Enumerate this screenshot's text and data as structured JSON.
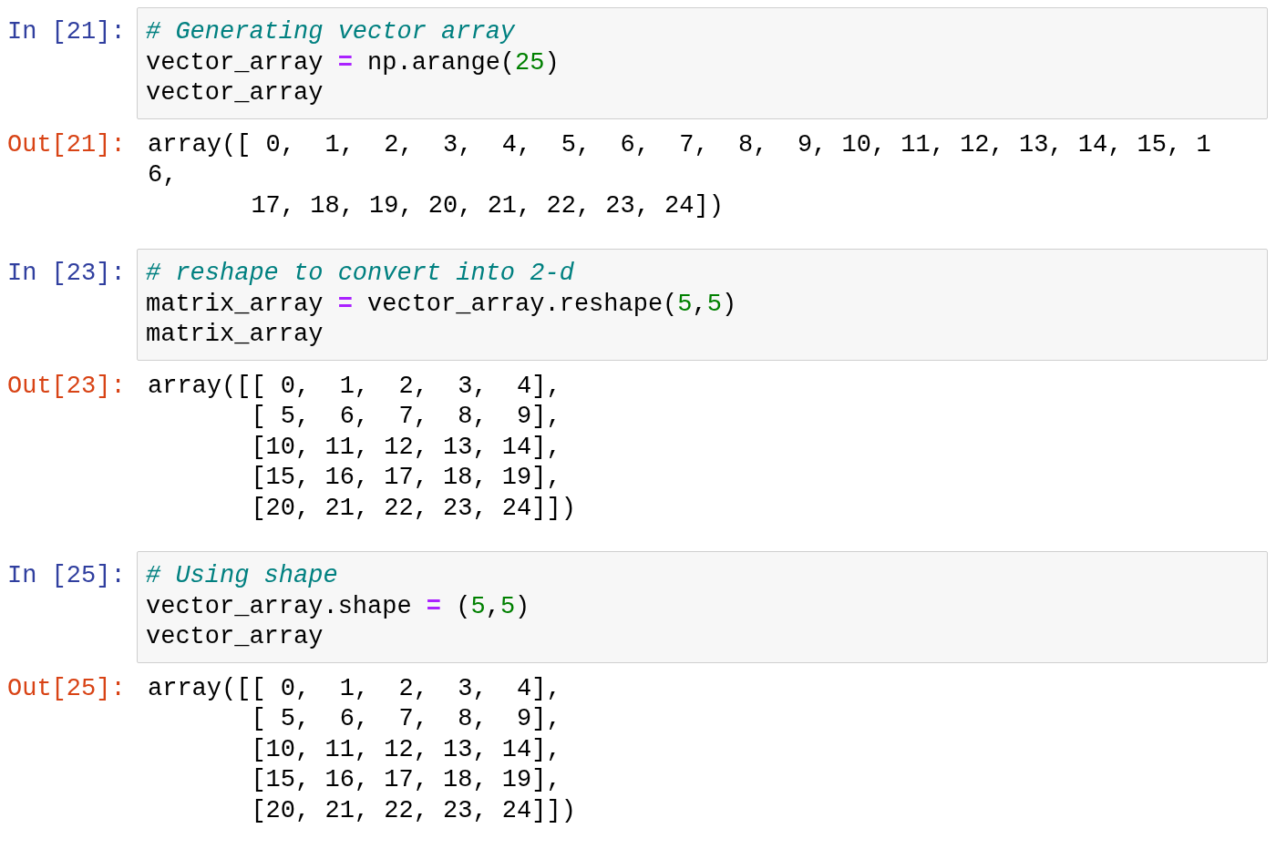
{
  "cells": [
    {
      "input_prompt": "In [21]:",
      "code_lines": [
        [
          {
            "kind": "comment",
            "text": "# Generating vector array"
          }
        ],
        [
          {
            "kind": "plain",
            "text": "vector_array "
          },
          {
            "kind": "operator",
            "text": "="
          },
          {
            "kind": "plain",
            "text": " np.arange("
          },
          {
            "kind": "number",
            "text": "25"
          },
          {
            "kind": "plain",
            "text": ")"
          }
        ],
        [
          {
            "kind": "plain",
            "text": "vector_array"
          }
        ]
      ],
      "output_prompt": "Out[21]:",
      "output_lines": [
        "array([ 0,  1,  2,  3,  4,  5,  6,  7,  8,  9, 10, 11, 12, 13, 14, 15, 1",
        "6,",
        "       17, 18, 19, 20, 21, 22, 23, 24])"
      ]
    },
    {
      "input_prompt": "In [23]:",
      "code_lines": [
        [
          {
            "kind": "comment",
            "text": "# reshape to convert into 2-d"
          }
        ],
        [
          {
            "kind": "plain",
            "text": "matrix_array "
          },
          {
            "kind": "operator",
            "text": "="
          },
          {
            "kind": "plain",
            "text": " vector_array.reshape("
          },
          {
            "kind": "number",
            "text": "5"
          },
          {
            "kind": "plain",
            "text": ","
          },
          {
            "kind": "number",
            "text": "5"
          },
          {
            "kind": "plain",
            "text": ")"
          }
        ],
        [
          {
            "kind": "plain",
            "text": "matrix_array"
          }
        ]
      ],
      "output_prompt": "Out[23]:",
      "output_lines": [
        "array([[ 0,  1,  2,  3,  4],",
        "       [ 5,  6,  7,  8,  9],",
        "       [10, 11, 12, 13, 14],",
        "       [15, 16, 17, 18, 19],",
        "       [20, 21, 22, 23, 24]])"
      ]
    },
    {
      "input_prompt": "In [25]:",
      "code_lines": [
        [
          {
            "kind": "comment",
            "text": "# Using shape"
          }
        ],
        [
          {
            "kind": "plain",
            "text": "vector_array.shape "
          },
          {
            "kind": "operator",
            "text": "="
          },
          {
            "kind": "plain",
            "text": " ("
          },
          {
            "kind": "number",
            "text": "5"
          },
          {
            "kind": "plain",
            "text": ","
          },
          {
            "kind": "number",
            "text": "5"
          },
          {
            "kind": "plain",
            "text": ")"
          }
        ],
        [
          {
            "kind": "plain",
            "text": "vector_array"
          }
        ]
      ],
      "output_prompt": "Out[25]:",
      "output_lines": [
        "array([[ 0,  1,  2,  3,  4],",
        "       [ 5,  6,  7,  8,  9],",
        "       [10, 11, 12, 13, 14],",
        "       [15, 16, 17, 18, 19],",
        "       [20, 21, 22, 23, 24]])"
      ]
    }
  ]
}
